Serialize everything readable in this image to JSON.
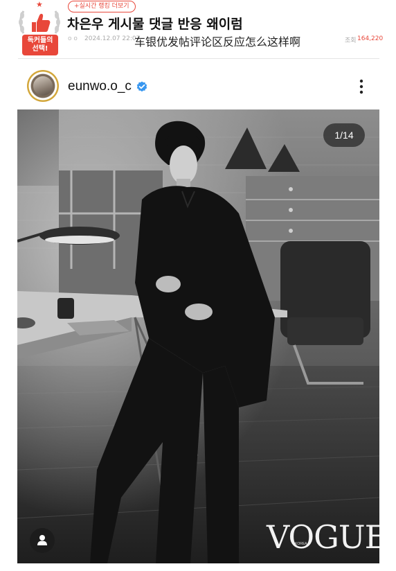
{
  "article": {
    "ranking_chip": "+실시간 랭킹 더보기",
    "badge_label_line1": "독커들의",
    "badge_label_line2": "선택!",
    "title": "차은우 게시물 댓글 반응 왜이럼",
    "date": "2024.12.07 22:07",
    "views_label": "조회",
    "views": "164,220",
    "overlay_caption": "车银优发帖评论区反应怎么这样啊"
  },
  "post": {
    "username": "eunwo.o_c",
    "counter": "1/14",
    "watermark": "VOGUE",
    "watermark_sub": "KOREA"
  },
  "colors": {
    "accent": "#e8473a",
    "verified": "#3897f0"
  },
  "icons": [
    "thumbs-up-icon",
    "star-icon",
    "verified-icon",
    "more-options-icon",
    "user-tag-icon"
  ]
}
